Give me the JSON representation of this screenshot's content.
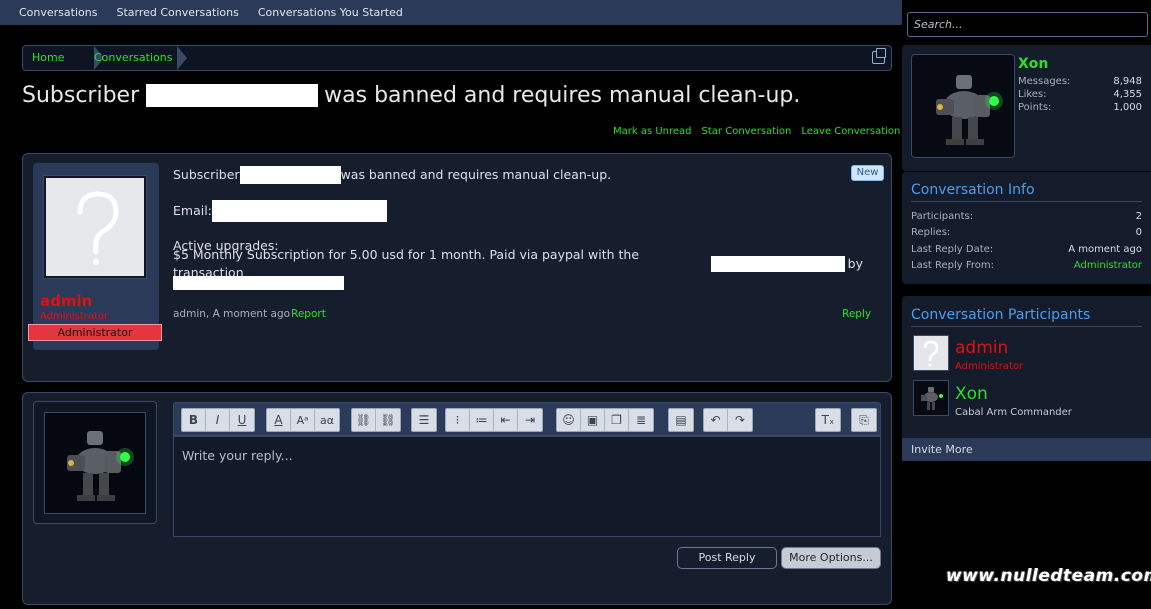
{
  "nav": {
    "items": [
      "Conversations",
      "Starred Conversations",
      "Conversations You Started"
    ]
  },
  "search": {
    "placeholder": "Search..."
  },
  "breadcrumb": {
    "home": "Home",
    "current": "Conversations"
  },
  "title": {
    "prefix": "Subscriber",
    "suffix": "was banned and requires manual clean-up."
  },
  "actions": {
    "mark_unread": "Mark as Unread",
    "star": "Star Conversation",
    "leave": "Leave Conversation"
  },
  "message": {
    "author": "admin",
    "author_title": "Administrator",
    "ribbon": "Administrator",
    "badge": "New",
    "line1_prefix": "Subscriber",
    "line1_suffix": "was banned and requires manual clean-up.",
    "email_label": "Email:",
    "upgrades_label": "Active upgrades:",
    "upgrade_text": "$5 Monthly Subscription for 5.00 usd for 1 month. Paid via paypal with the transaction",
    "upgrade_by": "by",
    "meta": "admin, A moment ago",
    "report": "Report",
    "reply": "Reply"
  },
  "reply_box": {
    "placeholder": "Write your reply...",
    "post_label": "Post Reply",
    "more_label": "More Options..."
  },
  "visitor": {
    "name": "Xon",
    "stats": [
      {
        "label": "Messages:",
        "value": "8,948"
      },
      {
        "label": "Likes:",
        "value": "4,355"
      },
      {
        "label": "Points:",
        "value": "1,000"
      }
    ]
  },
  "conversation_info": {
    "heading": "Conversation Info",
    "rows": [
      {
        "label": "Participants:",
        "value": "2"
      },
      {
        "label": "Replies:",
        "value": "0"
      },
      {
        "label": "Last Reply Date:",
        "value": "A moment ago"
      },
      {
        "label": "Last Reply From:",
        "value": "Administrator"
      }
    ]
  },
  "participants": {
    "heading": "Conversation Participants",
    "list": [
      {
        "name": "admin",
        "title": "Administrator",
        "color": "#e01010",
        "title_color": "#e01010"
      },
      {
        "name": "Xon",
        "title": "Cabal Arm Commander",
        "color": "#27e227",
        "title_color": "#c8ccd4"
      }
    ],
    "invite": "Invite More"
  },
  "watermark": "www.nulledteam.com",
  "colors": {
    "accent_green": "#27e227",
    "admin_red": "#e01010",
    "heading_blue": "#4a9eee",
    "panel_bg": "#161d2d",
    "nav_bg": "#2a3a58"
  }
}
